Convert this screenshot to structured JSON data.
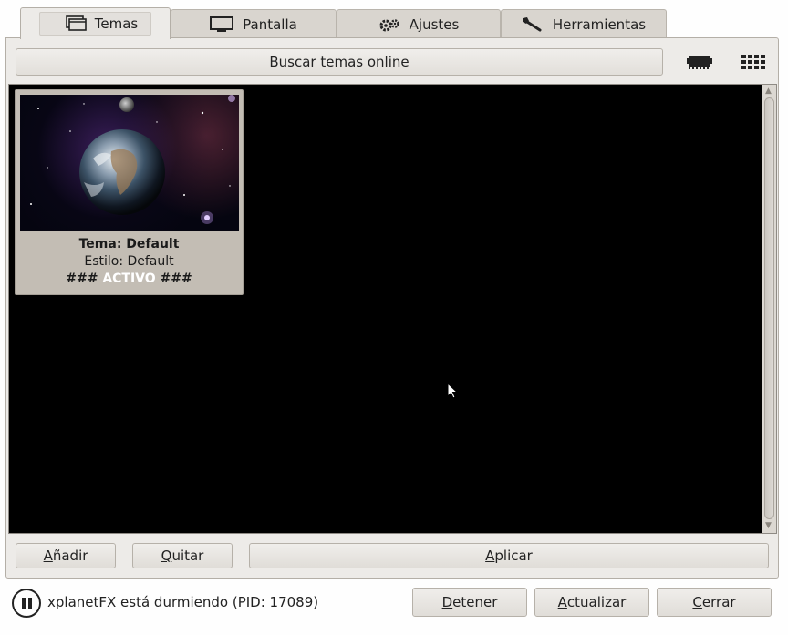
{
  "tabs": [
    {
      "label": "Temas",
      "icon": "windows-icon",
      "active": true
    },
    {
      "label": "Pantalla",
      "icon": "monitor-icon",
      "active": false
    },
    {
      "label": "Ajustes",
      "icon": "gears-icon",
      "active": false
    },
    {
      "label": "Herramientas",
      "icon": "wrench-icon",
      "active": false
    }
  ],
  "toolbar": {
    "search_online_label": "Buscar temas online",
    "view_large_icon": "filmstrip-icon",
    "view_grid_icon": "grid-icon"
  },
  "theme_card": {
    "title": "Tema: Default",
    "style": "Estilo: Default",
    "active_prefix": "### ",
    "active_word": "ACTIVO",
    "active_suffix": " ###"
  },
  "actions": {
    "add": {
      "underline": "A",
      "rest": "ñadir"
    },
    "remove": {
      "underline": "Q",
      "rest": "uitar"
    },
    "apply": {
      "underline": "A",
      "rest": "plicar"
    }
  },
  "status": {
    "text": "xplanetFX está durmiendo (PID: 17089)",
    "stop": {
      "underline": "D",
      "rest": "etener"
    },
    "update": {
      "underline": "A",
      "rest": "ctualizar"
    },
    "close": {
      "underline": "C",
      "rest": "errar"
    }
  },
  "colors": {
    "window_bg": "#edebe8",
    "gallery_bg": "#000000",
    "card_bg": "#c3bdb4",
    "active_highlight": "#ffffff"
  }
}
